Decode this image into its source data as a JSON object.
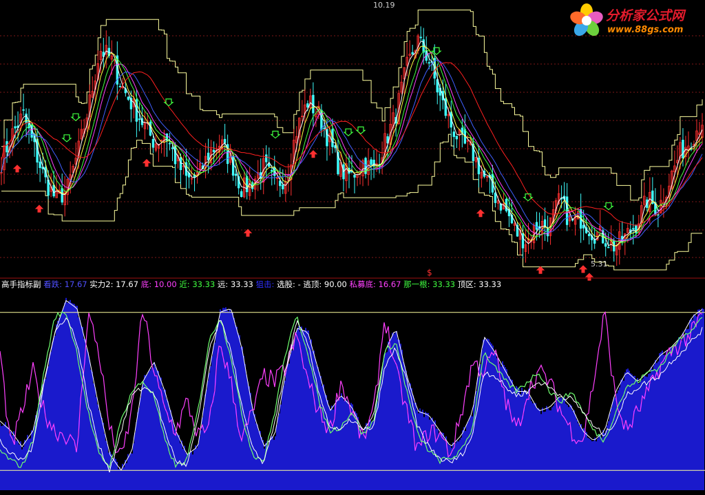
{
  "logo": {
    "title": "分析家公式网",
    "url": "www.88gs.com",
    "colors": {
      "petal1": "#ffcc00",
      "petal2": "#e85cc0",
      "petal3": "#6ccf3c",
      "petal4": "#3aa7e8",
      "petal5": "#ff6a2a",
      "text": "#e21b2c",
      "url": "#ff8a00"
    }
  },
  "indicator": {
    "name": "高手指标副",
    "items": [
      {
        "label": "看跌",
        "value": "17.67",
        "color": "#5050ff"
      },
      {
        "label": "实力2",
        "value": "17.67",
        "color": "#ffffff"
      },
      {
        "label": "底",
        "value": "10.00",
        "color": "#ff40ff"
      },
      {
        "label": "近",
        "value": "33.33",
        "color": "#40ff40"
      },
      {
        "label": "远",
        "value": "33.33",
        "color": "#ffffff"
      },
      {
        "label": "狙击",
        "value": "",
        "color": "#3030ff"
      },
      {
        "label": "选股",
        "value": "-",
        "color": "#ffffff"
      },
      {
        "label": "逃顶",
        "value": "90.00",
        "color": "#ffffff"
      },
      {
        "label": "私募底",
        "value": "16.67",
        "color": "#ff40ff"
      },
      {
        "label": "那一根",
        "value": "33.33",
        "color": "#40ff40"
      },
      {
        "label": "顶区",
        "value": "33.33",
        "color": "#ffffff"
      }
    ]
  },
  "chart_data": [
    {
      "type": "candlestick",
      "panel": "price",
      "annotations": {
        "high_label": "10.19",
        "low_label": "5.31"
      },
      "high": 10.19,
      "low": 5.31,
      "colors": {
        "up": "#ff3030",
        "down": "#40ffff",
        "ma1": "#ffffff",
        "ma2": "#ffff40",
        "ma3": "#ff40ff",
        "ma4": "#40ff40",
        "ma5": "#4060ff",
        "ma6": "#ff2020",
        "band": "#ffffa0",
        "grid": "#801818"
      },
      "price_curve": [
        7.2,
        7.8,
        8.2,
        7.5,
        6.8,
        6.4,
        6.6,
        7.4,
        8.4,
        9.6,
        9.4,
        8.8,
        8.4,
        8.0,
        7.6,
        7.8,
        7.2,
        6.8,
        6.9,
        7.4,
        7.6,
        7.2,
        6.6,
        6.8,
        7.1,
        6.7,
        6.9,
        7.9,
        8.5,
        8.2,
        7.6,
        7.0,
        6.9,
        7.2,
        7.0,
        7.6,
        8.2,
        9.2,
        9.8,
        9.4,
        8.6,
        8.0,
        7.6,
        7.4,
        6.9,
        6.5,
        6.2,
        5.7,
        5.5,
        5.9,
        5.8,
        6.4,
        5.9,
        6.0,
        5.7,
        5.6,
        5.4,
        5.6,
        5.9,
        6.4,
        6.2,
        6.8,
        7.4,
        7.7,
        8.1
      ],
      "arrows_down": [
        110,
        97,
        245,
        400,
        506,
        524,
        634,
        767,
        884
      ],
      "arrows_up": [
        25,
        57,
        213,
        360,
        455,
        698,
        785,
        847,
        856
      ],
      "range_marker": {
        "symbol": "$"
      }
    },
    {
      "type": "area",
      "panel": "indicator",
      "series": [
        {
          "role": "filled",
          "values": [
            35,
            30,
            22,
            30,
            55,
            80,
            96,
            92,
            70,
            42,
            18,
            10,
            20,
            55,
            65,
            50,
            30,
            18,
            22,
            60,
            90,
            92,
            72,
            40,
            22,
            28,
            60,
            82,
            80,
            60,
            40,
            48,
            42,
            30,
            38,
            70,
            82,
            58,
            40,
            38,
            30,
            22,
            28,
            40,
            78,
            70,
            60,
            50,
            50,
            40,
            42,
            48,
            42,
            30,
            25,
            30,
            50,
            60,
            55,
            60,
            68,
            72,
            78,
            88,
            92
          ]
        },
        {
          "role": "magenta",
          "values": [
            70,
            20,
            40,
            60,
            40,
            30,
            28,
            20,
            90,
            70,
            30,
            15,
            40,
            92,
            60,
            40,
            30,
            45,
            28,
            30,
            75,
            55,
            25,
            40,
            58,
            55,
            62,
            78,
            55,
            40,
            30,
            55,
            40,
            25,
            40,
            88,
            60,
            40,
            20,
            30,
            28,
            18,
            40,
            65,
            60,
            70,
            45,
            30,
            50,
            60,
            55,
            40,
            30,
            25,
            55,
            90,
            45,
            30,
            40,
            50,
            62,
            70,
            75,
            80,
            90
          ]
        },
        {
          "role": "green",
          "values": [
            20,
            15,
            12,
            25,
            60,
            88,
            90,
            70,
            40,
            18,
            12,
            35,
            50,
            55,
            48,
            25,
            12,
            15,
            40,
            75,
            88,
            68,
            38,
            18,
            15,
            40,
            70,
            88,
            70,
            45,
            30,
            32,
            40,
            28,
            35,
            70,
            75,
            50,
            28,
            20,
            15,
            16,
            20,
            32,
            70,
            62,
            55,
            50,
            55,
            60,
            50,
            45,
            50,
            40,
            30,
            25,
            40,
            52,
            55,
            60,
            62,
            70,
            78,
            82,
            88
          ]
        },
        {
          "role": "white",
          "values": [
            25,
            18,
            15,
            22,
            55,
            80,
            88,
            75,
            45,
            22,
            10,
            30,
            48,
            52,
            50,
            30,
            15,
            12,
            35,
            70,
            86,
            72,
            42,
            20,
            14,
            35,
            62,
            85,
            74,
            50,
            32,
            30,
            36,
            30,
            32,
            62,
            72,
            55,
            32,
            22,
            16,
            14,
            18,
            28,
            60,
            58,
            52,
            48,
            50,
            55,
            52,
            48,
            46,
            40,
            32,
            28,
            35,
            48,
            52,
            55,
            58,
            65,
            70,
            76,
            82
          ]
        }
      ],
      "levels": [
        90,
        10
      ],
      "colors": {
        "fill": "#1010c0",
        "fill_edge": "#ffffff",
        "magenta": "#ff40ff",
        "green": "#70ff70",
        "white": "#ffffff",
        "level": "#ffffa0",
        "vbar": "#2020ff"
      }
    }
  ]
}
